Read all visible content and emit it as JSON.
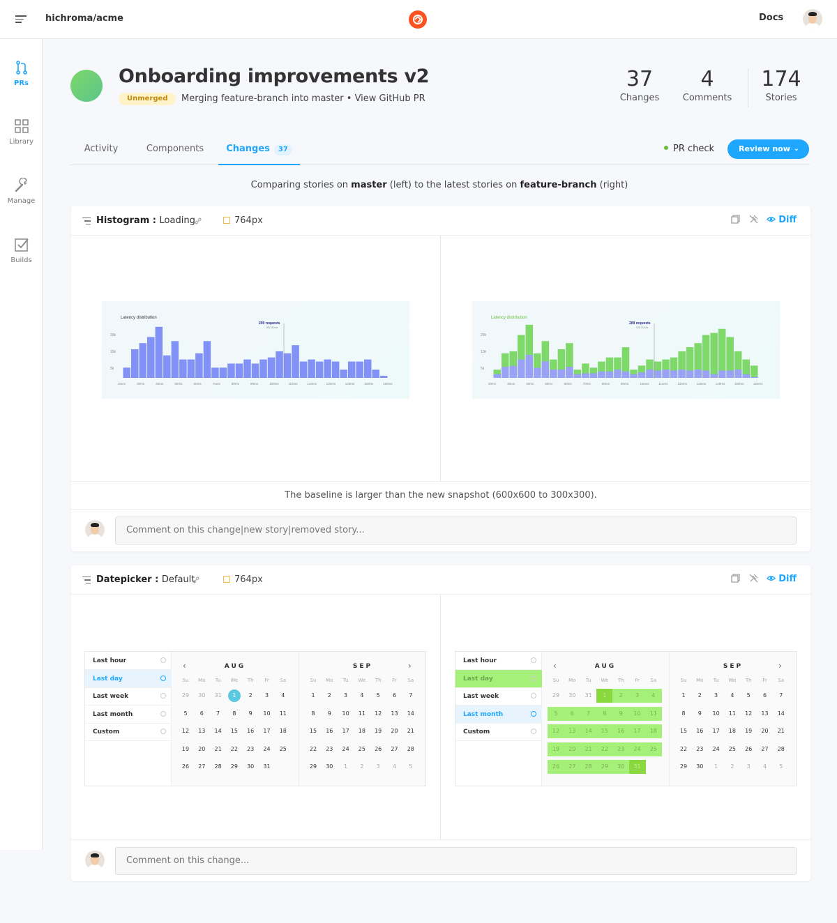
{
  "topbar": {
    "repo": "hichroma/acme",
    "docs_label": "Docs"
  },
  "sidebar": {
    "items": [
      {
        "label": "PRs",
        "icon": "pull-request-icon"
      },
      {
        "label": "Library",
        "icon": "grid-icon"
      },
      {
        "label": "Manage",
        "icon": "wrench-icon"
      },
      {
        "label": "Builds",
        "icon": "checkbox-icon"
      }
    ]
  },
  "pr": {
    "title": "Onboarding improvements v2",
    "status": "Unmerged",
    "subtitle": "Merging feature-branch into master • View GitHub PR",
    "stats": [
      {
        "value": "37",
        "label": "Changes"
      },
      {
        "value": "4",
        "label": "Comments"
      },
      {
        "value": "174",
        "label": "Stories"
      }
    ]
  },
  "tabs": [
    {
      "label": "Activity"
    },
    {
      "label": "Components"
    },
    {
      "label": "Changes",
      "count": "37"
    }
  ],
  "pr_check_label": "PR check",
  "review_button": "Review now",
  "compare": {
    "pre": "Comparing stories on ",
    "base": "master",
    "mid": " (left) to the latest stories on ",
    "head": "feature-branch",
    "post": " (right)"
  },
  "cards": [
    {
      "component": "Histogram",
      "story": "Loading",
      "viewport": "764px",
      "diff_label": "Diff",
      "note": "The baseline is larger than the new snapshot (600x600 to 300x300).",
      "comment_placeholder": "Comment on this change|new story|removed story..."
    },
    {
      "component": "Datepicker",
      "story": "Default",
      "viewport": "764px",
      "diff_label": "Diff",
      "comment_placeholder": "Comment on this change..."
    }
  ],
  "histogram": {
    "title": "Latency distribution",
    "tooltip": "209 requests",
    "tooltip_sub": "105-110ms",
    "y_ticks": [
      "20k",
      "15k",
      "5k"
    ],
    "x_ticks": [
      "20ms",
      "30ms",
      "40ms",
      "50ms",
      "60ms",
      "70ms",
      "80ms",
      "90ms",
      "100ms",
      "110ms",
      "120ms",
      "130ms",
      "140ms",
      "150ms",
      "160ms"
    ],
    "baseline_values": [
      5,
      14,
      17,
      20,
      25,
      11,
      18,
      9,
      9,
      12,
      18,
      5,
      5,
      7,
      7,
      9,
      7,
      9,
      10,
      13,
      12,
      16,
      8,
      9,
      8,
      9,
      8,
      4,
      8,
      8,
      9,
      4,
      1
    ],
    "new_values": [
      4,
      12,
      13,
      21,
      26,
      12,
      18,
      9,
      14,
      17,
      4,
      7,
      5,
      8,
      10,
      10,
      15,
      4,
      6,
      9,
      8,
      9,
      10,
      13,
      15,
      17,
      21,
      22,
      24,
      20,
      13,
      9,
      6
    ]
  },
  "datepicker": {
    "presets": [
      "Last hour",
      "Last day",
      "Last week",
      "Last month",
      "Custom"
    ],
    "dow": [
      "Su",
      "Mo",
      "Tu",
      "We",
      "Th",
      "Fr",
      "Sa"
    ],
    "months": [
      {
        "name": "AUG",
        "days": [
          [
            "29",
            "30",
            "31",
            "1",
            "2",
            "3",
            "4"
          ],
          [
            "5",
            "6",
            "7",
            "8",
            "9",
            "10",
            "11"
          ],
          [
            "12",
            "13",
            "14",
            "15",
            "16",
            "17",
            "18"
          ],
          [
            "19",
            "20",
            "21",
            "22",
            "23",
            "24",
            "25"
          ],
          [
            "26",
            "27",
            "28",
            "29",
            "30",
            "31",
            ""
          ]
        ]
      },
      {
        "name": "SEP",
        "days": [
          [
            "1",
            "2",
            "3",
            "4",
            "5",
            "6",
            "7"
          ],
          [
            "8",
            "9",
            "10",
            "11",
            "12",
            "13",
            "14"
          ],
          [
            "15",
            "16",
            "17",
            "18",
            "19",
            "20",
            "21"
          ],
          [
            "22",
            "23",
            "24",
            "25",
            "26",
            "27",
            "28"
          ],
          [
            "29",
            "30",
            "1",
            "2",
            "3",
            "4",
            "5"
          ]
        ]
      }
    ]
  },
  "colors": {
    "accent": "#1ea7fd",
    "brand": "#fc521f",
    "unmerged_bg": "#fff3c9",
    "bar_baseline": "#8191f5",
    "bar_new": "#7ed86a",
    "range": "#a5f078"
  }
}
